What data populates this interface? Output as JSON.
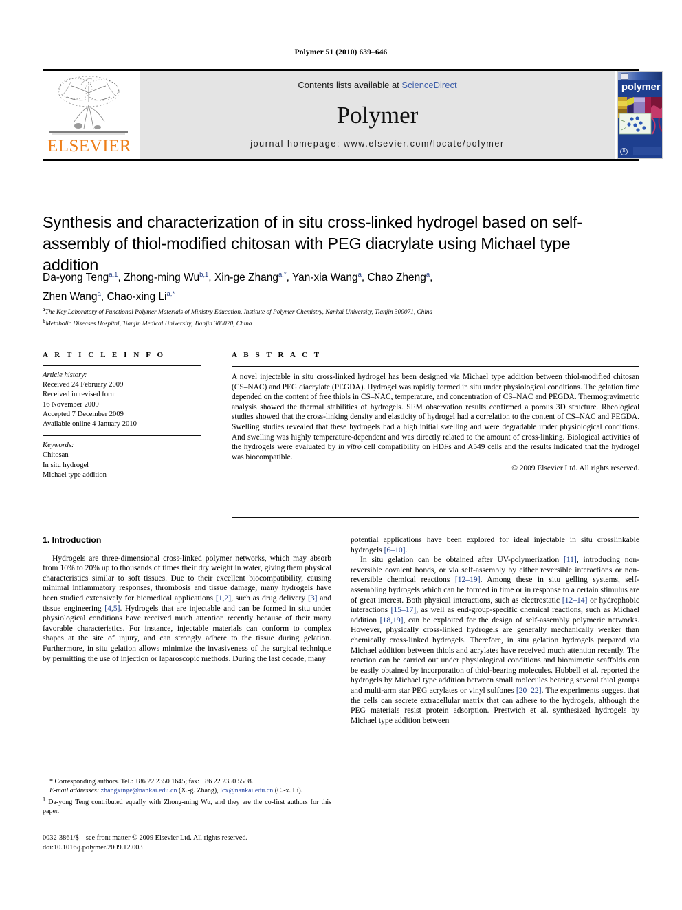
{
  "running_head": "Polymer 51 (2010) 639–646",
  "masthead": {
    "contents_text": "Contents lists available at ",
    "sciencedirect_link": "ScienceDirect",
    "journal_name": "Polymer",
    "homepage": "journal homepage: www.elsevier.com/locate/polymer",
    "publisher_wordmark": "ELSEVIER",
    "cover_title": "polymer",
    "brand_orange": "#EE7F1A",
    "brand_link_blue": "#3b5ca8",
    "cover_blue": "#1e3f8f"
  },
  "article": {
    "title": "Synthesis and characterization of in situ cross-linked hydrogel based on self-assembly of thiol-modified chitosan with PEG diacrylate using Michael type addition",
    "authors_line1_parts": [
      {
        "name": "Da-yong Teng",
        "sup": "a,1",
        "sep": ", "
      },
      {
        "name": "Zhong-ming Wu",
        "sup": "b,1",
        "sep": ", "
      },
      {
        "name": "Xin-ge Zhang",
        "sup": "a,*",
        "sep": ", "
      },
      {
        "name": "Yan-xia Wang",
        "sup": "a",
        "sep": ", "
      },
      {
        "name": "Chao Zheng",
        "sup": "a",
        "sep": ","
      }
    ],
    "authors_line2_parts": [
      {
        "name": "Zhen Wang",
        "sup": "a",
        "sep": ", "
      },
      {
        "name": "Chao-xing Li",
        "sup": "a,*",
        "sep": ""
      }
    ],
    "affiliations": [
      {
        "mark": "a",
        "text": "The Key Laboratory of Functional Polymer Materials of Ministry Education, Institute of Polymer Chemistry, Nankai University, Tianjin 300071, China"
      },
      {
        "mark": "b",
        "text": "Metabolic Diseases Hospital, Tianjin Medical University, Tianjin 300070, China"
      }
    ]
  },
  "article_info": {
    "heading": "A R T I C L E   I N F O",
    "history_label": "Article history:",
    "history": [
      "Received 24 February 2009",
      "Received in revised form",
      "16 November 2009",
      "Accepted 7 December 2009",
      "Available online 4 January 2010"
    ],
    "keywords_label": "Keywords:",
    "keywords": [
      "Chitosan",
      "In situ hydrogel",
      "Michael type addition"
    ]
  },
  "abstract": {
    "heading": "A B S T R A C T",
    "text": "A novel injectable in situ cross-linked hydrogel has been designed via Michael type addition between thiol-modified chitosan (CS–NAC) and PEG diacrylate (PEGDA). Hydrogel was rapidly formed in situ under physiological conditions. The gelation time depended on the content of free thiols in CS–NAC, temperature, and concentration of CS–NAC and PEGDA. Thermogravimetric analysis showed the thermal stabilities of hydrogels. SEM observation results confirmed a porous 3D structure. Rheological studies showed that the cross-linking density and elasticity of hydrogel had a correlation to the content of CS–NAC and PEGDA. Swelling studies revealed that these hydrogels had a high initial swelling and were degradable under physiological conditions. And swelling was highly temperature-dependent and was directly related to the amount of cross-linking. Biological activities of the hydrogels were evaluated by ",
    "text_italic": "in vitro",
    "text_tail": " cell compatibility on HDFs and A549 cells and the results indicated that the hydrogel was biocompatible.",
    "copyright": "© 2009 Elsevier Ltd. All rights reserved."
  },
  "body": {
    "section_heading": "1.  Introduction",
    "left_p1_a": "Hydrogels are three-dimensional cross-linked polymer networks, which may absorb from 10% to 20% up to thousands of times their dry weight in water, giving them physical characteristics similar to soft tissues. Due to their excellent biocompatibility, causing minimal inflammatory responses, thrombosis and tissue damage, many hydrogels have been studied extensively for biomedical applications ",
    "ref_1_2": "[1,2]",
    "left_p1_b": ", such as drug delivery ",
    "ref_3": "[3]",
    "left_p1_c": " and tissue engineering ",
    "ref_4_5": "[4,5]",
    "left_p1_d": ". Hydrogels that are injectable and can be formed in situ under physiological conditions have received much attention recently because of their many favorable characteristics. For instance, injectable materials can conform to complex shapes at the site of injury, and can strongly adhere to the tissue during gelation. Furthermore, in situ gelation allows minimize the invasiveness of the surgical technique by permitting the use of injection or laparoscopic methods. During the last decade, many ",
    "right_p1_tail": "potential applications have been explored for ideal injectable in situ crosslinkable hydrogels ",
    "ref_6_10": "[6–10]",
    "right_p1_end": ".",
    "right_p2_a": "In situ gelation can be obtained after UV-polymerization ",
    "ref_11": "[11]",
    "right_p2_b": ", introducing non-reversible covalent bonds, or via self-assembly by either reversible interactions or non-reversible chemical reactions ",
    "ref_12_19": "[12–19]",
    "right_p2_c": ". Among these in situ gelling systems, self-assembling hydrogels which can be formed in time or in response to a certain stimulus are of great interest. Both physical interactions, such as electrostatic ",
    "ref_12_14": "[12–14]",
    "right_p2_d": " or hydrophobic interactions ",
    "ref_15_17": "[15–17]",
    "right_p2_e": ", as well as end-group-specific chemical reactions, such as Michael addition ",
    "ref_18_19": "[18,19]",
    "right_p2_f": ", can be exploited for the design of self-assembly polymeric networks. However, physically cross-linked hydrogels are generally mechanically weaker than chemically cross-linked hydrogels. Therefore, in situ gelation hydrogels prepared via Michael addition between thiols and acrylates have received much attention recently. The reaction can be carried out under physiological conditions and biomimetic scaffolds can be easily obtained by incorporation of thiol-bearing molecules. Hubbell et al. reported the hydrogels by Michael type addition between small molecules bearing several thiol groups and multi-arm star PEG acrylates or vinyl sulfones ",
    "ref_20_22": "[20–22]",
    "right_p2_g": ". The experiments suggest that the cells can secrete extracellular matrix that can adhere to the hydrogels, although the PEG materials resist protein adsorption. Prestwich et al. synthesized hydrogels by Michael type addition between"
  },
  "footnotes": {
    "corresponding": "*  Corresponding authors. Tel.: +86 22 2350 1645; fax: +86 22 2350 5598.",
    "email_label": "E-mail addresses:",
    "email_1": "zhangxinge@nankai.edu.cn",
    "email_1_owner": " (X.-g. Zhang), ",
    "email_2": "lcx@nankai.edu.cn",
    "email_2_owner": " (C.-x. Li).",
    "equal_mark": "1",
    "equal_contrib": "  Da-yong Teng contributed equally with Zhong-ming Wu, and they are the co-first authors for this paper."
  },
  "imprint": {
    "issn_line": "0032-3861/$ – see front matter © 2009 Elsevier Ltd. All rights reserved.",
    "doi_line": "doi:10.1016/j.polymer.2009.12.003"
  }
}
